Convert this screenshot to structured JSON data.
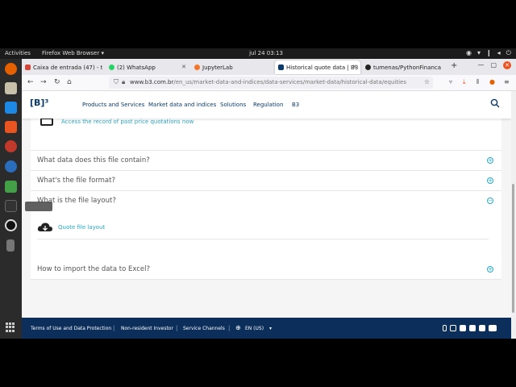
{
  "topbar": {
    "activities": "Activities",
    "app_menu": "Firefox Web Browser ▾",
    "clock": "jul 24  03:13"
  },
  "browser": {
    "tabs": [
      {
        "label": "Caixa de entrada (47) - ti",
        "favicon_color": "#d44638"
      },
      {
        "label": "(2) WhatsApp",
        "favicon_color": "#25d366"
      },
      {
        "label": "JupyterLab",
        "favicon_color": "#f37626"
      },
      {
        "label": "Historical quote data | B3",
        "favicon_color": "#0a3a6b"
      },
      {
        "label": "tumenas/PythonFinanca",
        "favicon_color": "#222222"
      }
    ],
    "url_host": "www.b3.com.br",
    "url_path": "/en_us/market-data-and-indices/data-services/market-data/historical-data/equities"
  },
  "site": {
    "logo": "[B]³",
    "nav": [
      "Products and Services",
      "Market data and indices",
      "Solutions",
      "Regulation",
      "B3"
    ],
    "top_link": "Access the record of past price quotations now",
    "faq": [
      {
        "question": "What data does this file contain?",
        "toggle": "+"
      },
      {
        "question": "What's the file format?",
        "toggle": "+"
      },
      {
        "question": "What is the file layout?",
        "toggle": "−"
      }
    ],
    "layout_link": "Quote file layout",
    "faq_bottom": {
      "question": "How to import the data to Excel?",
      "toggle": "+"
    },
    "footer": {
      "terms": "Terms of Use and Data Protection",
      "nonresident": "Non-resident Investor",
      "service": "Service Channels",
      "language": "EN (US)"
    }
  },
  "colors": {
    "accent": "#27a9c4",
    "brand": "#0a3a6b",
    "footer": "#0b2e5a"
  }
}
